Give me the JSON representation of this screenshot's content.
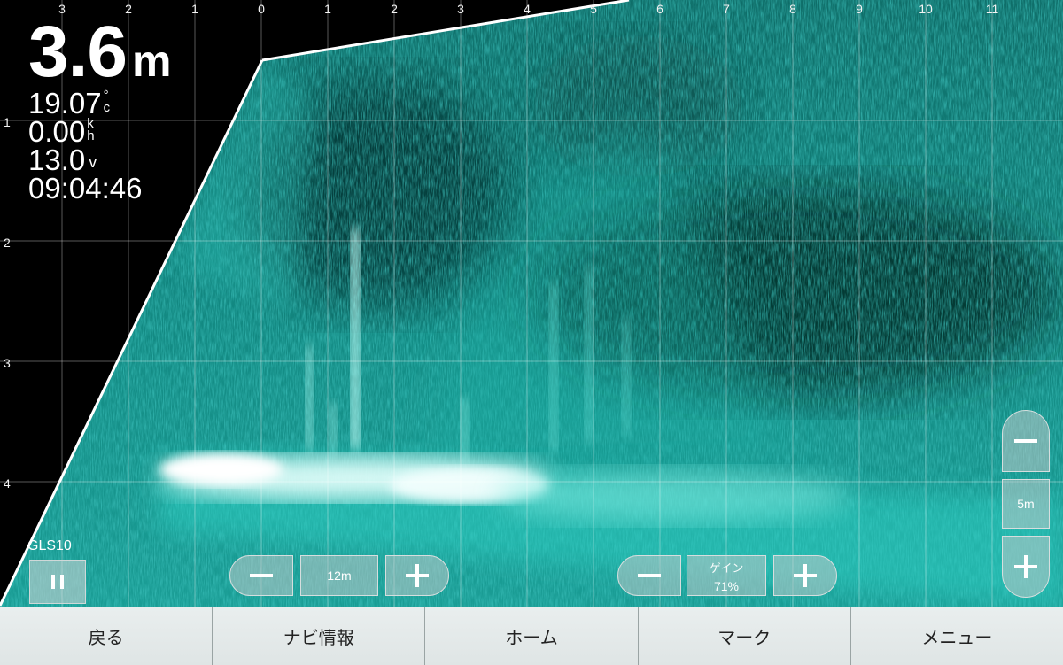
{
  "readouts": {
    "depth_value": "3.6",
    "depth_unit": "m",
    "water_temp": "19.07",
    "water_temp_unit_top": "°",
    "water_temp_unit_bottom": "c",
    "speed": "0.00",
    "speed_unit_top": "k",
    "speed_unit_bottom": "h",
    "voltage": "13.0",
    "voltage_unit": "v",
    "time": "09:04:46"
  },
  "axes": {
    "x_ticks": [
      "3",
      "2",
      "1",
      "0",
      "1",
      "2",
      "3",
      "4",
      "5",
      "6",
      "7",
      "8",
      "9",
      "10",
      "11"
    ],
    "y_ticks": [
      "1",
      "2",
      "3",
      "4"
    ]
  },
  "device": {
    "model": "GLS10",
    "pause_icon": "pause-icon"
  },
  "range_control": {
    "minus_icon": "minus-icon",
    "value": "12m",
    "plus_icon": "plus-icon"
  },
  "gain_control": {
    "minus_icon": "minus-icon",
    "label": "ゲイン",
    "value": "71%",
    "plus_icon": "plus-icon"
  },
  "zoom_control": {
    "zoom_out_icon": "minus-icon",
    "value": "5m",
    "zoom_in_icon": "plus-icon"
  },
  "navbar": {
    "back": "戻る",
    "nav_info": "ナビ情報",
    "home": "ホーム",
    "mark": "マーク",
    "menu": "メニュー"
  },
  "colors": {
    "sonar_teal": "#1fb3a8",
    "sonar_bright": "#8ff5ee",
    "bottom_echo": "#ffffff",
    "navbar_bg": "#e4eaea"
  }
}
